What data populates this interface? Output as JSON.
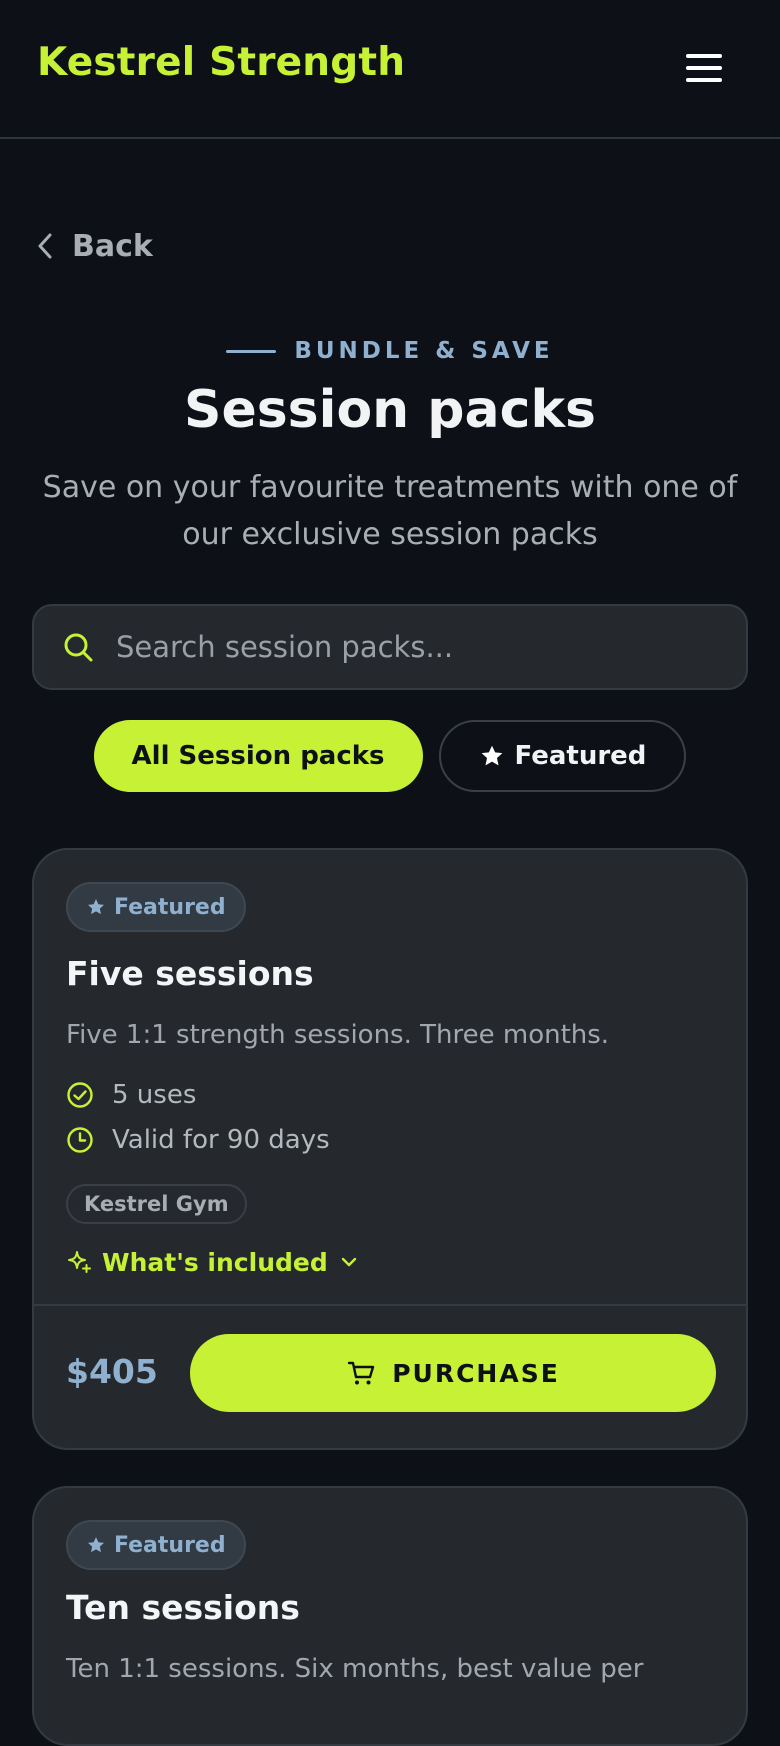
{
  "brand": "Kestrel Strength",
  "nav": {
    "back_label": "Back"
  },
  "hero": {
    "eyebrow": "BUNDLE & SAVE",
    "title": "Session packs",
    "subtitle": "Save on your favourite treatments with one of our exclusive session packs"
  },
  "search": {
    "placeholder": "Search session packs..."
  },
  "filters": [
    {
      "label": "All Session packs",
      "active": true
    },
    {
      "label": "Featured",
      "active": false
    }
  ],
  "packs": [
    {
      "badge": "Featured",
      "title": "Five sessions",
      "description": "Five 1:1 strength sessions. Three months.",
      "uses": "5 uses",
      "validity": "Valid for 90 days",
      "location": "Kestrel Gym",
      "included_label": "What's included",
      "price": "$405",
      "cta": "PURCHASE"
    },
    {
      "badge": "Featured",
      "title": "Ten sessions",
      "description": "Ten 1:1 sessions. Six months, best value per"
    }
  ],
  "colors": {
    "accent": "#c6f135",
    "background": "#0d1117",
    "card": "#25292e",
    "muted_blue": "#8fb1cf"
  }
}
